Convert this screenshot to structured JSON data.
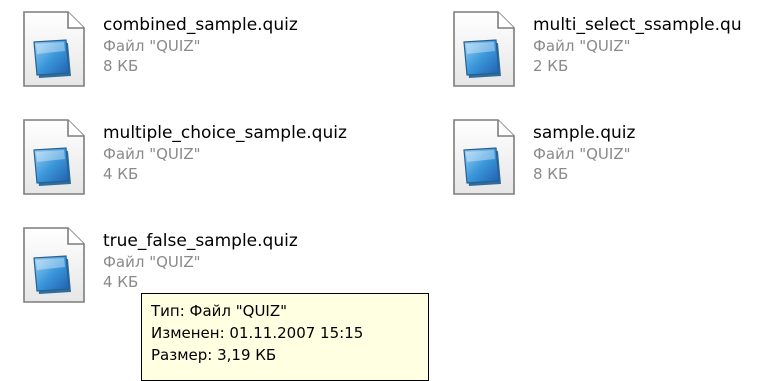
{
  "files": [
    {
      "name": "combined_sample.quiz",
      "type": "Файл \"QUIZ\"",
      "size": "8 КБ"
    },
    {
      "name": "multi_select_ssample.qu",
      "type": "Файл \"QUIZ\"",
      "size": "2 КБ"
    },
    {
      "name": "multiple_choice_sample.quiz",
      "type": "Файл \"QUIZ\"",
      "size": "4 КБ"
    },
    {
      "name": "sample.quiz",
      "type": "Файл \"QUIZ\"",
      "size": "8 КБ"
    },
    {
      "name": "true_false_sample.quiz",
      "type": "Файл \"QUIZ\"",
      "size": "4 КБ"
    }
  ],
  "tooltip": {
    "type_line": "Тип: Файл \"QUIZ\"",
    "modified_line": "Изменен: 01.11.2007 15:15",
    "size_line": "Размер: 3,19 КБ"
  },
  "icon": "generic-document-file-icon"
}
